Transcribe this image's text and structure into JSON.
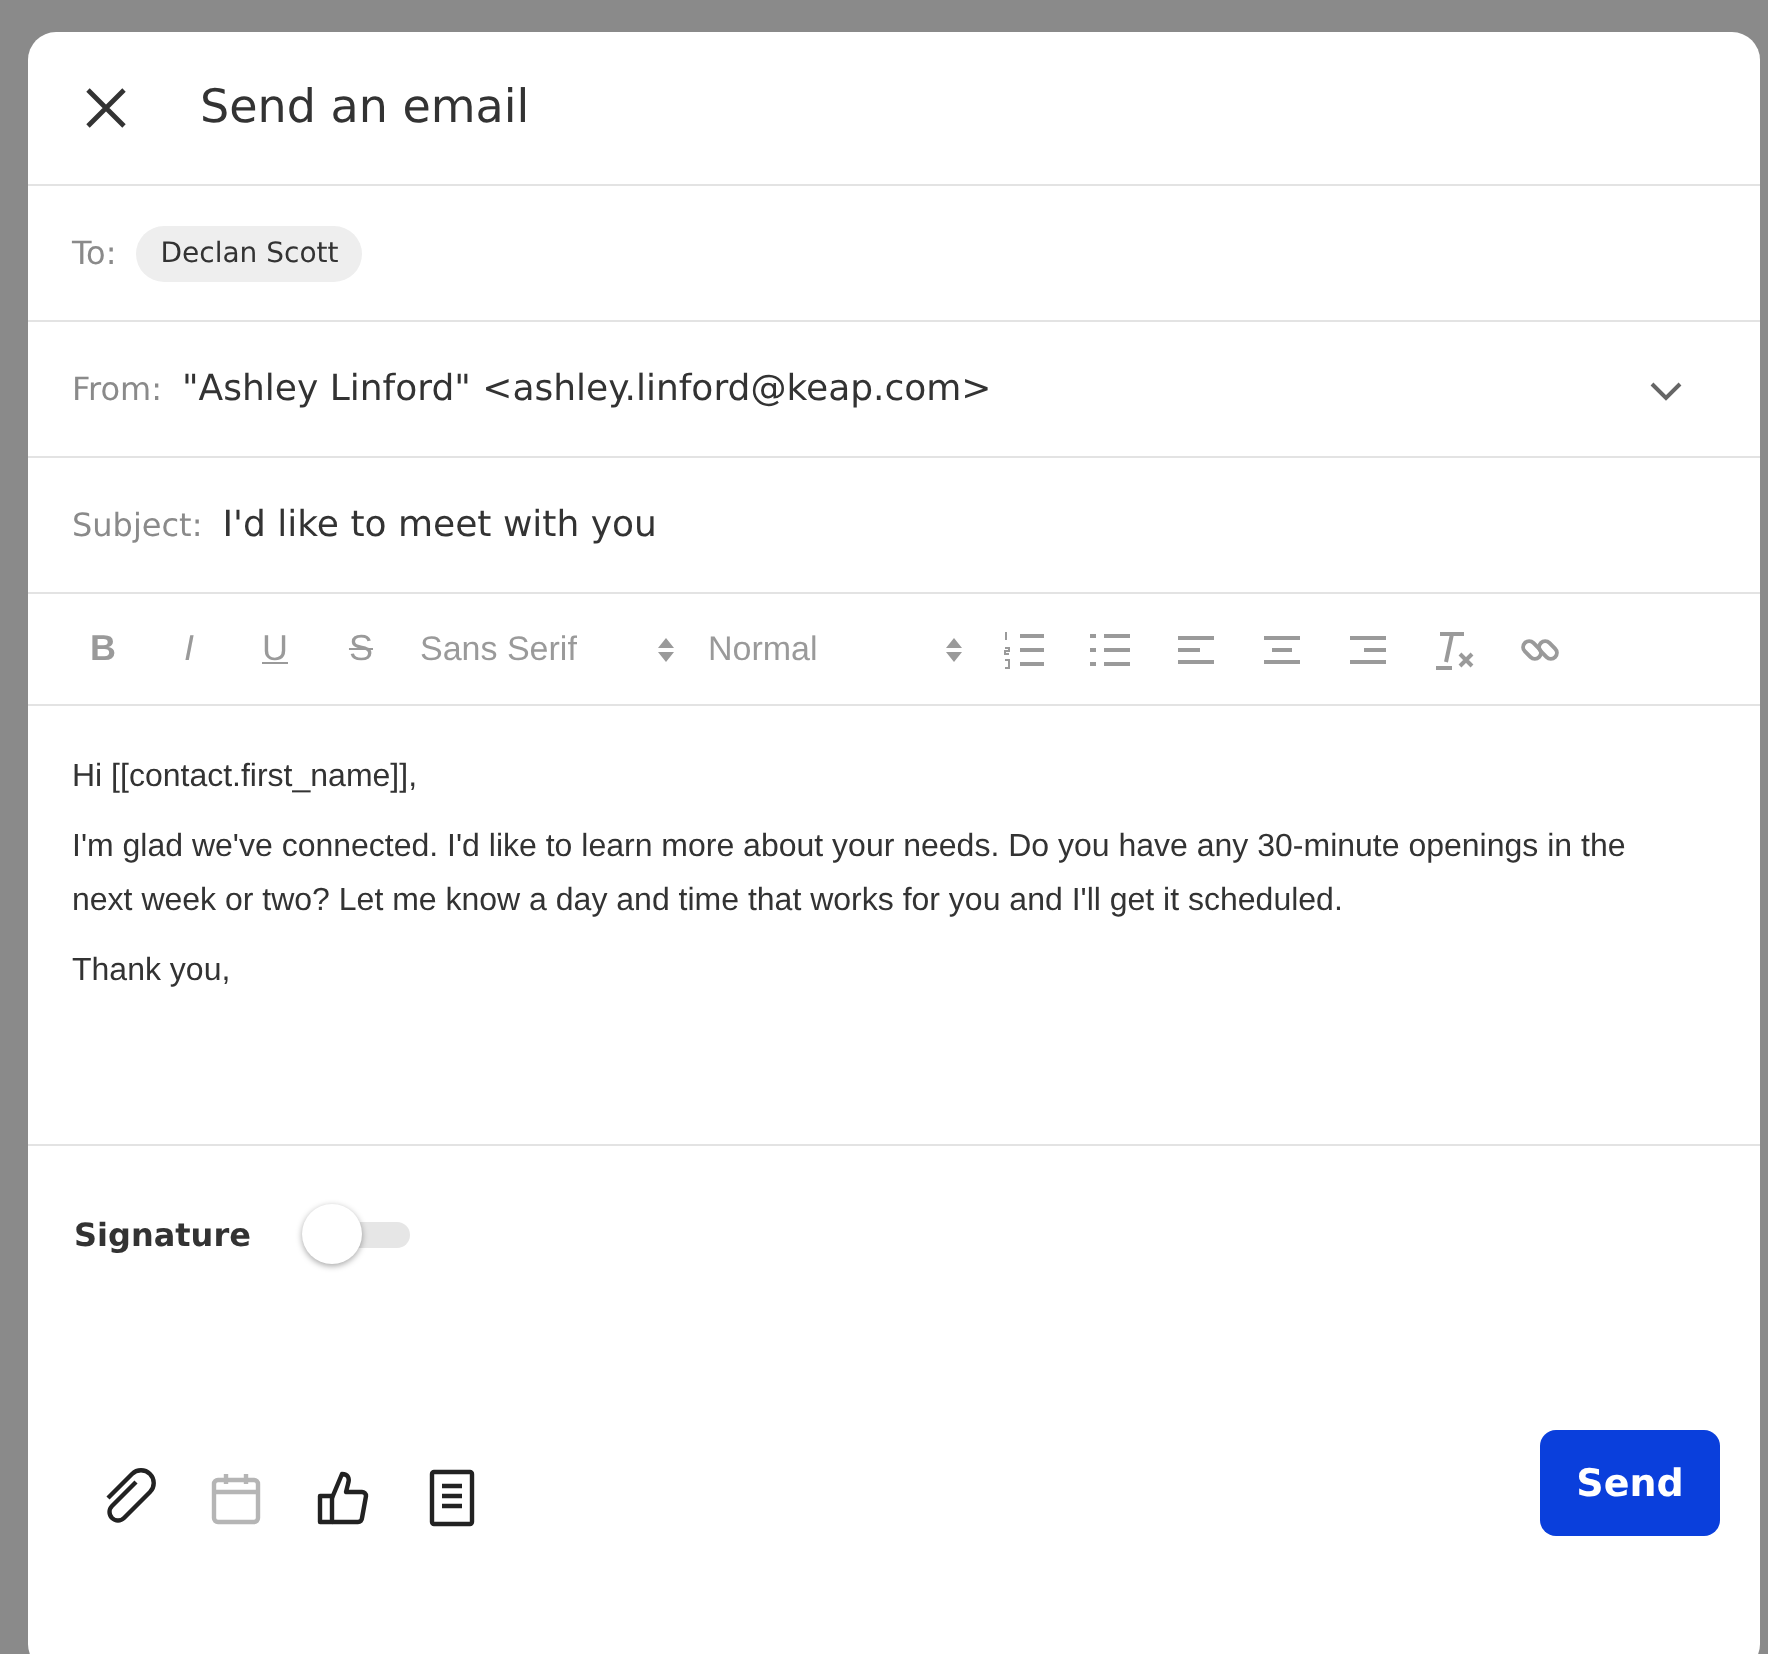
{
  "dialog": {
    "title": "Send an email"
  },
  "to": {
    "label": "To:",
    "recipients": [
      "Declan Scott"
    ]
  },
  "from": {
    "label": "From:",
    "value": "\"Ashley Linford\" <ashley.linford@keap.com>"
  },
  "subject": {
    "label": "Subject:",
    "value": "I'd like to meet with you"
  },
  "toolbar": [
    {
      "kind": "bold",
      "label": "B"
    },
    {
      "kind": "italic",
      "label": "I"
    },
    {
      "kind": "underline",
      "label": "U"
    },
    {
      "kind": "strike",
      "label": "S"
    },
    {
      "kind": "select",
      "label": "Sans Serif"
    },
    {
      "kind": "select",
      "label": "Normal"
    },
    {
      "kind": "ordered-list"
    },
    {
      "kind": "bullet-list"
    },
    {
      "kind": "align-left"
    },
    {
      "kind": "align-center"
    },
    {
      "kind": "align-right"
    },
    {
      "kind": "clear-format"
    },
    {
      "kind": "link"
    }
  ],
  "body": [
    "Hi [[contact.first_name]],",
    "I'm glad we've connected. I'd like to learn more about your needs. Do you have any 30-minute openings in the next week or two? Let me know a day and time that works for you and I'll get it scheduled.",
    "Thank you,"
  ],
  "signature": {
    "label": "Signature",
    "on": false
  },
  "footer_tools": [
    {
      "kind": "attach",
      "disabled": false
    },
    {
      "kind": "calendar",
      "disabled": true
    },
    {
      "kind": "thumbs-up",
      "disabled": false
    },
    {
      "kind": "document",
      "disabled": false
    }
  ],
  "send_button": "Send"
}
